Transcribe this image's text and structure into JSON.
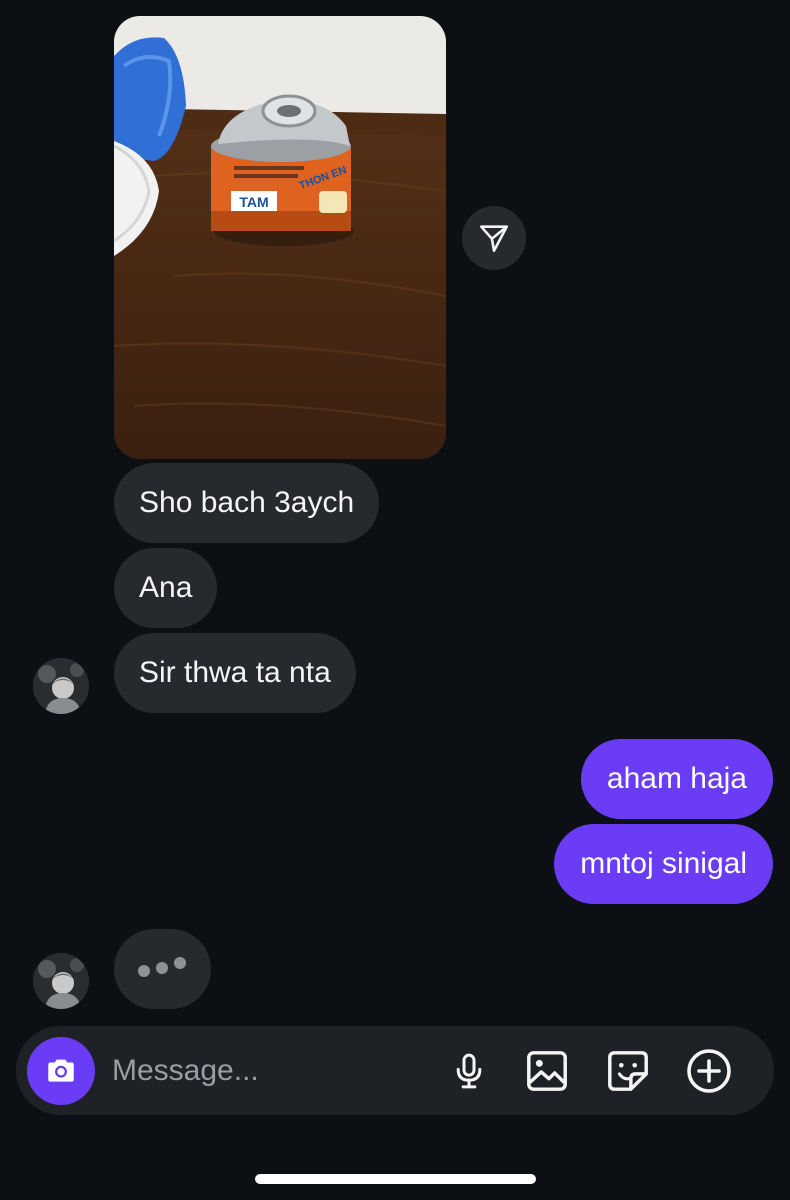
{
  "thread": {
    "photo": {
      "label": "Photo of a can of tuna on a wooden table"
    },
    "incoming": [
      {
        "text": "Sho bach 3aych"
      },
      {
        "text": "Ana"
      },
      {
        "text": "Sir thwa ta nta"
      }
    ],
    "outgoing": [
      {
        "text": "aham haja"
      },
      {
        "text": "mntoj sinigal"
      }
    ]
  },
  "composer": {
    "placeholder": "Message..."
  },
  "colors": {
    "background": "#0c1014",
    "incoming_bubble": "#262a2f",
    "outgoing_bubble": "#6a3cf6",
    "composer": "#1e2227"
  },
  "icons": [
    "share-icon",
    "camera-icon",
    "microphone-icon",
    "gallery-icon",
    "sticker-icon",
    "plus-icon"
  ]
}
